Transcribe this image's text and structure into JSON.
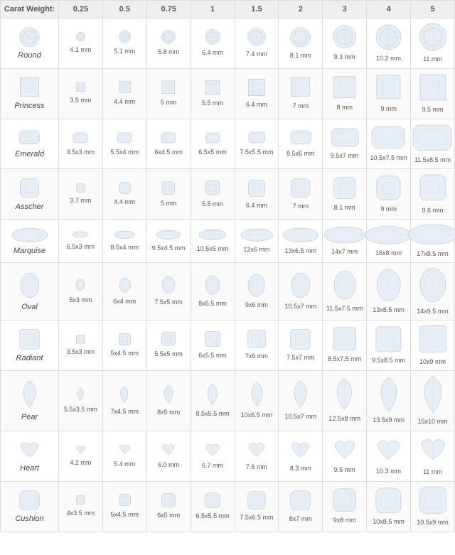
{
  "header": {
    "carat_label": "Carat Weight:",
    "weights": [
      "0.25",
      "0.5",
      "0.75",
      "1",
      "1.5",
      "2",
      "3",
      "4",
      "5"
    ]
  },
  "shapes": [
    {
      "name": "Round",
      "type": "round",
      "sizes": [
        "4.1 mm",
        "5.1 mm",
        "5.8 mm",
        "6.4 mm",
        "7.4 mm",
        "8.1 mm",
        "9.3 mm",
        "10.2 mm",
        "11 mm"
      ]
    },
    {
      "name": "Princess",
      "type": "princess",
      "sizes": [
        "3.5 mm",
        "4.4 mm",
        "5 mm",
        "5.5 mm",
        "6.4 mm",
        "7 mm",
        "8 mm",
        "9 mm",
        "9.5 mm"
      ]
    },
    {
      "name": "Emerald",
      "type": "emerald",
      "sizes": [
        "4.5x3 mm",
        "5.5x4 mm",
        "6x4.5 mm",
        "6.5x5 mm",
        "7.5x5.5 mm",
        "8.5x6 mm",
        "9.5x7 mm",
        "10.5x7.5 mm",
        "11.5x8.5 mm"
      ]
    },
    {
      "name": "Asscher",
      "type": "asscher",
      "sizes": [
        "3.7 mm",
        "4.4 mm",
        "5 mm",
        "5.5 mm",
        "6.4 mm",
        "7 mm",
        "8.1 mm",
        "9 mm",
        "9.6 mm"
      ]
    },
    {
      "name": "Marquise",
      "type": "marquise",
      "sizes": [
        "6.5x3 mm",
        "8.5x4 mm",
        "9.5x4.5 mm",
        "10.5x5 mm",
        "12x6 mm",
        "13x6.5 mm",
        "14x7 mm",
        "16x8 mm",
        "17x8.5 mm"
      ]
    },
    {
      "name": "Oval",
      "type": "oval",
      "sizes": [
        "5x3 mm",
        "6x4 mm",
        "7.5x5 mm",
        "8x5.5 mm",
        "9x6 mm",
        "10.5x7 mm",
        "11.5x7.5 mm",
        "13x8.5 mm",
        "14x9.5 mm"
      ]
    },
    {
      "name": "Radiant",
      "type": "radiant",
      "sizes": [
        "3.5x3 mm",
        "5x4.5 mm",
        "5.5x5 mm",
        "6x5.5 mm",
        "7x6 mm",
        "7.5x7 mm",
        "8.5x7.5 mm",
        "9.5x8.5 mm",
        "10x9 mm"
      ]
    },
    {
      "name": "Pear",
      "type": "pear",
      "sizes": [
        "5.5x3.5 mm",
        "7x4.5 mm",
        "8x5 mm",
        "8.5x5.5 mm",
        "10x6.5 mm",
        "10.5x7 mm",
        "12.5x8 mm",
        "13.5x9 mm",
        "15x10 mm"
      ]
    },
    {
      "name": "Heart",
      "type": "heart",
      "sizes": [
        "4.2 mm",
        "5.4 mm",
        "6.0 mm",
        "6.7 mm",
        "7.6 mm",
        "8.3 mm",
        "9.5 mm",
        "10.3 mm",
        "11 mm"
      ]
    },
    {
      "name": "Cushion",
      "type": "cushion",
      "sizes": [
        "4x3.5 mm",
        "5x4.5 mm",
        "6x5 mm",
        "6.5x5.5 mm",
        "7.5x6.5 mm",
        "8x7 mm",
        "9x8 mm",
        "10x8.5 mm",
        "10.5x9 mm"
      ]
    }
  ]
}
